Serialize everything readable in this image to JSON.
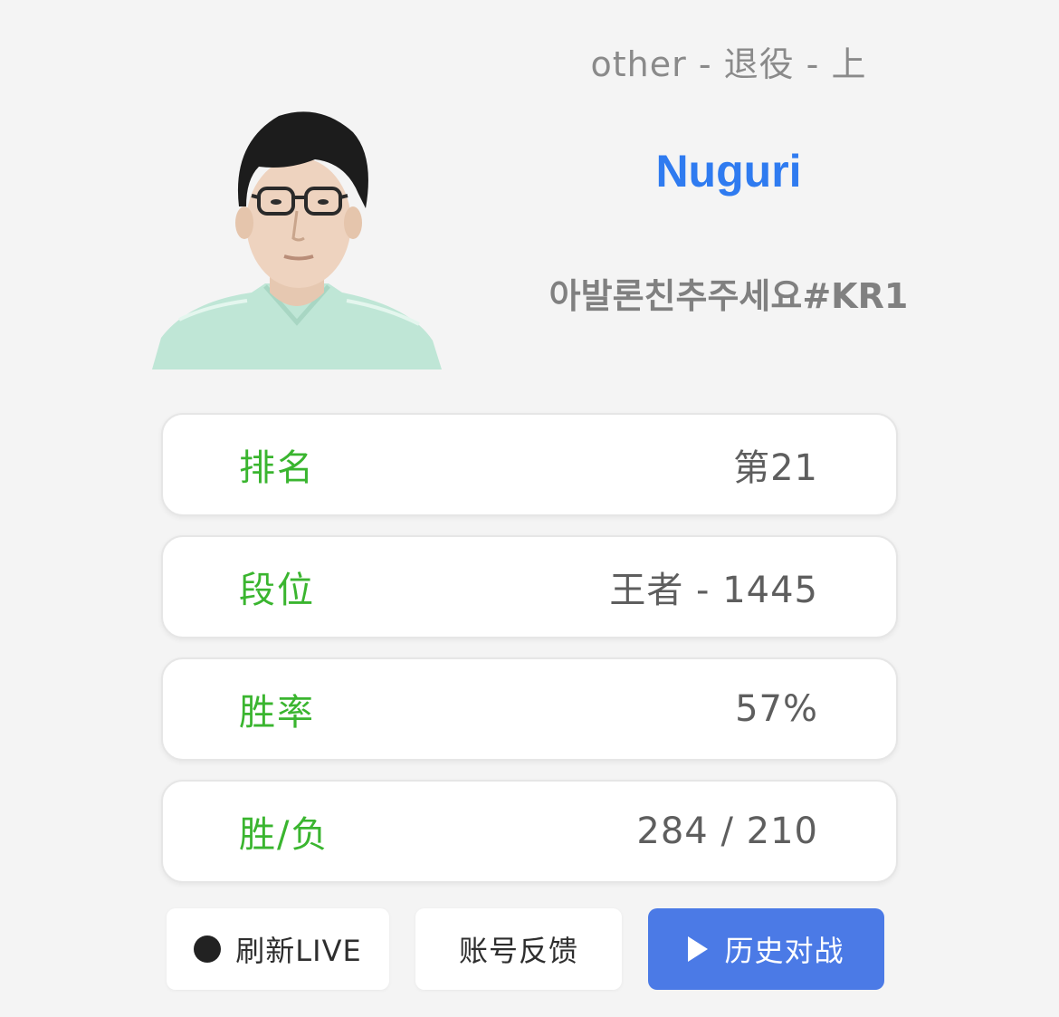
{
  "profile": {
    "meta": "other - 退役 - 上",
    "name": "Nuguri",
    "account": "아발론친추주세요#KR1"
  },
  "stats": [
    {
      "label": "排名",
      "value": "第21"
    },
    {
      "label": "段位",
      "value": "王者 - 1445"
    },
    {
      "label": "胜率",
      "value": "57%"
    },
    {
      "label": "胜/负",
      "value": "284 / 210"
    }
  ],
  "actions": {
    "live_label": "刷新LIVE",
    "feedback_label": "账号反馈",
    "history_label": "历史对战"
  },
  "colors": {
    "name": "#2f7bf0",
    "label": "#3ab52f",
    "primary_button": "#4b7ae6"
  },
  "icons": {
    "live": "dot-icon",
    "history": "play-icon"
  }
}
